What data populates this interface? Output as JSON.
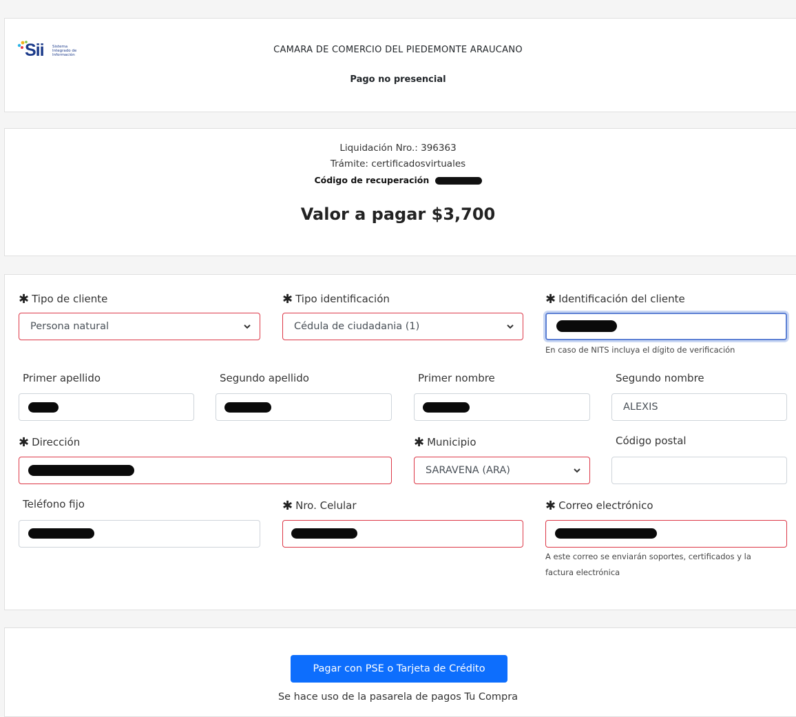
{
  "header": {
    "logo_text": "Sii",
    "logo_subtext": "Sistema Integrado de Información",
    "organization": "CAMARA DE COMERCIO DEL PIEDEMONTE ARAUCANO",
    "subtitle": "Pago no presencial"
  },
  "summary": {
    "liquidacion": "Liquidación Nro.: 396363",
    "tramite": "Trámite: certificadosvirtuales",
    "codigo_label": "Código de recuperación",
    "valor": "Valor a pagar $3,700"
  },
  "form": {
    "tipo_cliente": {
      "label": "Tipo de cliente",
      "value": "Persona natural"
    },
    "tipo_identificacion": {
      "label": "Tipo identificación",
      "value": "Cédula de ciudadania (1)"
    },
    "identificacion": {
      "label": "Identificación del cliente",
      "help": "En caso de NITS incluya el dígito de verificación"
    },
    "primer_apellido": {
      "label": "Primer apellido"
    },
    "segundo_apellido": {
      "label": "Segundo apellido"
    },
    "primer_nombre": {
      "label": "Primer nombre"
    },
    "segundo_nombre": {
      "label": "Segundo nombre",
      "value": "ALEXIS"
    },
    "direccion": {
      "label": "Dirección"
    },
    "municipio": {
      "label": "Municipio",
      "value": "SARAVENA (ARA)"
    },
    "codigo_postal": {
      "label": "Código postal",
      "value": ""
    },
    "telefono_fijo": {
      "label": "Teléfono fijo"
    },
    "celular": {
      "label": "Nro. Celular"
    },
    "correo": {
      "label": "Correo electrónico",
      "help_1": "A este correo se enviarán soportes, certificados y la",
      "help_2": "factura electrónica"
    }
  },
  "payment": {
    "button_label": "Pagar con PSE o Tarjeta de Crédito",
    "note": "Se hace uso de la pasarela de pagos Tu Compra"
  },
  "colors": {
    "primary": "#0d6efd",
    "required_border": "#dc3545",
    "focus_border": "#5b7fd4"
  }
}
